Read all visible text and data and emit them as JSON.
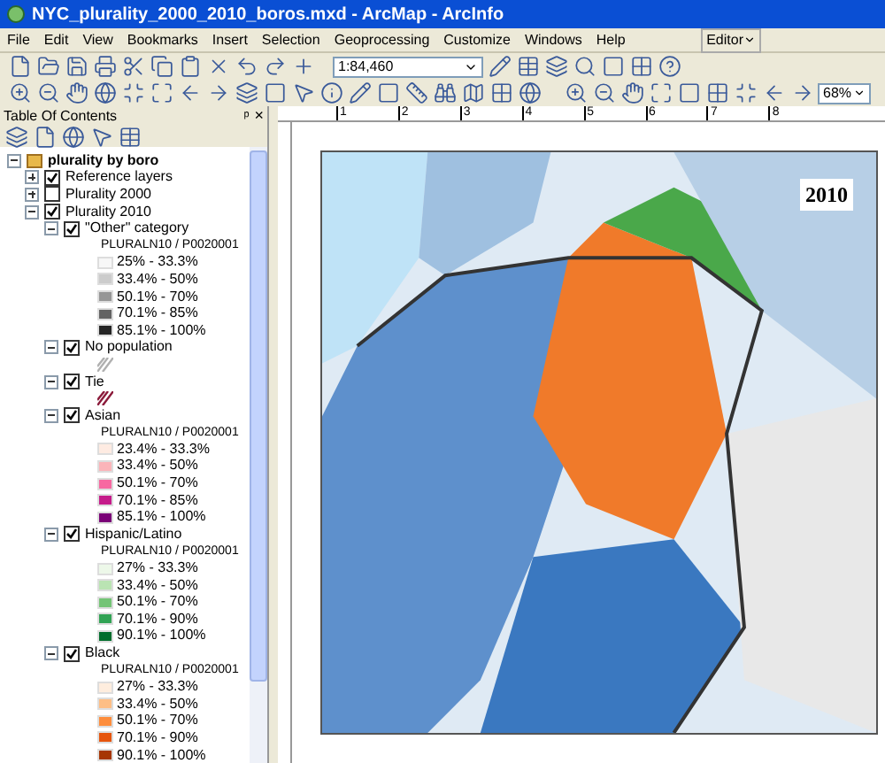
{
  "window": {
    "title": "NYC_plurality_2000_2010_boros.mxd - ArcMap - ArcInfo"
  },
  "menu": [
    "File",
    "Edit",
    "View",
    "Bookmarks",
    "Insert",
    "Selection",
    "Geoprocessing",
    "Customize",
    "Windows",
    "Help"
  ],
  "editor": {
    "label": "Editor"
  },
  "scale": {
    "value": "1:84,460"
  },
  "zoom": {
    "value": "68%"
  },
  "toc": {
    "title": "Table Of Contents",
    "pin": "ᵖ",
    "close": "×",
    "root": {
      "label": "plurality by boro",
      "expanded": true,
      "children": [
        {
          "label": "Reference layers",
          "checked": true,
          "expanded": false
        },
        {
          "label": "Plurality 2000",
          "checked": false,
          "expanded": false
        },
        {
          "label": "Plurality 2010",
          "checked": true,
          "expanded": true,
          "children": [
            {
              "label": "\"Other\" category",
              "checked": true,
              "expanded": true,
              "kind": "classes",
              "field": "PLURALN10 / P0020001",
              "classes": [
                {
                  "label": "25% - 33.3%",
                  "color": "#f7f7f7"
                },
                {
                  "label": "33.4% - 50%",
                  "color": "#cccccc"
                },
                {
                  "label": "50.1% - 70%",
                  "color": "#969696"
                },
                {
                  "label": "70.1% - 85%",
                  "color": "#636363"
                },
                {
                  "label": "85.1% - 100%",
                  "color": "#252525"
                }
              ]
            },
            {
              "label": "No population",
              "checked": true,
              "expanded": true,
              "kind": "hatch",
              "color": "#b0b0b0"
            },
            {
              "label": "Tie",
              "checked": true,
              "expanded": true,
              "kind": "hatch",
              "color": "#8b1a3a"
            },
            {
              "label": "Asian",
              "checked": true,
              "expanded": true,
              "kind": "classes",
              "field": "PLURALN10 / P0020001",
              "classes": [
                {
                  "label": "23.4% - 33.3%",
                  "color": "#feebe2"
                },
                {
                  "label": "33.4% - 50%",
                  "color": "#fbb4b9"
                },
                {
                  "label": "50.1% - 70%",
                  "color": "#f768a1"
                },
                {
                  "label": "70.1% - 85%",
                  "color": "#c51b8a"
                },
                {
                  "label": "85.1% - 100%",
                  "color": "#7a0177"
                }
              ]
            },
            {
              "label": "Hispanic/Latino",
              "checked": true,
              "expanded": true,
              "kind": "classes",
              "field": "PLURALN10 / P0020001",
              "classes": [
                {
                  "label": "27% - 33.3%",
                  "color": "#edf8e9"
                },
                {
                  "label": "33.4% - 50%",
                  "color": "#bae4b3"
                },
                {
                  "label": "50.1% - 70%",
                  "color": "#74c476"
                },
                {
                  "label": "70.1% - 90%",
                  "color": "#31a354"
                },
                {
                  "label": "90.1% - 100%",
                  "color": "#006d2c"
                }
              ]
            },
            {
              "label": "Black",
              "checked": true,
              "expanded": true,
              "kind": "classes",
              "field": "PLURALN10 / P0020001",
              "classes": [
                {
                  "label": "27% - 33.3%",
                  "color": "#feedde"
                },
                {
                  "label": "33.4% - 50%",
                  "color": "#fdbe85"
                },
                {
                  "label": "50.1% - 70%",
                  "color": "#fd8d3c"
                },
                {
                  "label": "70.1% - 90%",
                  "color": "#e6550d"
                },
                {
                  "label": "90.1% - 100%",
                  "color": "#a63603"
                }
              ]
            }
          ]
        }
      ]
    }
  },
  "ruler": [
    "1",
    "2",
    "3",
    "4",
    "5",
    "6",
    "7",
    "8"
  ],
  "map": {
    "year": "2010"
  }
}
